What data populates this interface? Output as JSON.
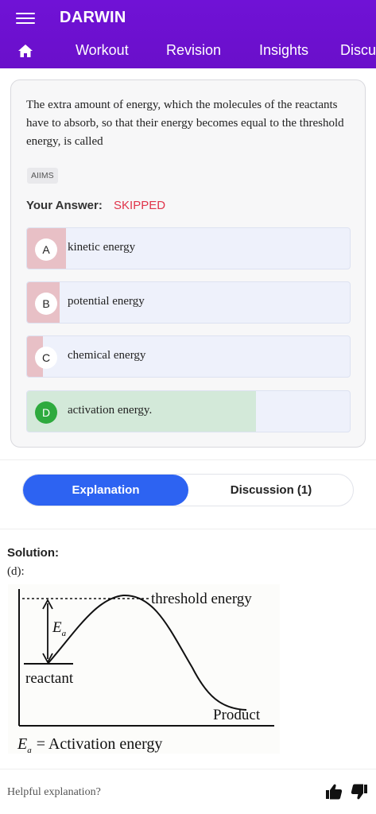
{
  "app": {
    "title": "DARWIN",
    "nav": [
      "Workout",
      "Revision",
      "Insights",
      "Discu"
    ]
  },
  "question": {
    "text": "The extra amount of energy, which the molecules of the reactants have to absorb, so that their energy becomes equal to the threshold energy, is called",
    "tag": "AIIMS",
    "your_answer_label": "Your Answer:",
    "your_answer_value": "SKIPPED",
    "options": [
      {
        "letter": "A",
        "text": "kinetic energy",
        "fill_fraction": 0.12,
        "state": "wrong-share"
      },
      {
        "letter": "B",
        "text": "potential energy",
        "fill_fraction": 0.1,
        "state": "wrong-share"
      },
      {
        "letter": "C",
        "text": "chemical energy",
        "fill_fraction": 0.05,
        "state": "wrong-share"
      },
      {
        "letter": "D",
        "text": "activation energy.",
        "fill_fraction": 0.71,
        "state": "correct"
      }
    ]
  },
  "tabs": {
    "explanation": "Explanation",
    "discussion": "Discussion (1)"
  },
  "solution": {
    "label": "Solution:",
    "answer": "(d):",
    "diagram": {
      "threshold_label": "threshold energy",
      "ea_label": "E",
      "ea_sub": "a",
      "reactant_label": "reactant",
      "product_label": "Product",
      "caption_e": "E",
      "caption_sub": "a",
      "caption_rest": "= Activation energy"
    }
  },
  "feedback": {
    "prompt": "Helpful explanation?"
  },
  "colors": {
    "appbar": "#6b10cc",
    "accent_blue": "#2d63f2",
    "skipped_red": "#e0344a",
    "wrong_fill": "#e8c0c6",
    "correct_fill": "#d3e9d9",
    "correct_badge": "#2eaa3e"
  }
}
